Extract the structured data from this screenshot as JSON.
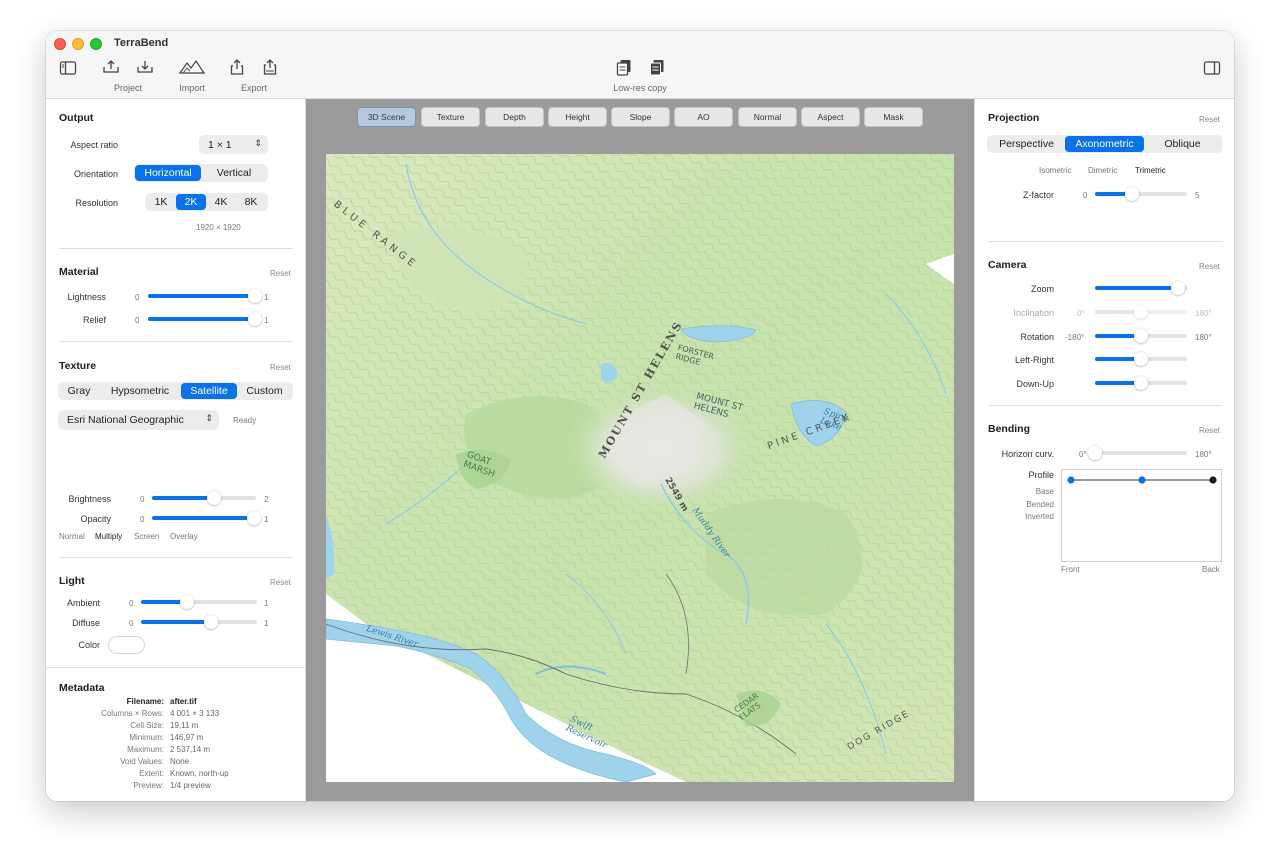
{
  "window": {
    "title": "TerraBend"
  },
  "toolbar": {
    "project_label": "Project",
    "import_label": "Import",
    "export_label": "Export",
    "lowres_label": "Low-res copy"
  },
  "output": {
    "title": "Output",
    "aspect_label": "Aspect ratio",
    "aspect_value": "1 × 1",
    "orientation_label": "Orientation",
    "orientation_options": [
      "Horizontal",
      "Vertical"
    ],
    "resolution_label": "Resolution",
    "resolution_options": [
      "1K",
      "2K",
      "4K",
      "8K"
    ],
    "resolution_size": "1920 × 1920"
  },
  "material": {
    "title": "Material",
    "reset": "Reset",
    "lightness_label": "Lightness",
    "lightness_min": "0",
    "lightness_max": "1",
    "lightness_value": 0.98,
    "relief_label": "Relief",
    "relief_min": "0",
    "relief_max": "1",
    "relief_value": 0.98
  },
  "texture": {
    "title": "Texture",
    "reset": "Reset",
    "modes": [
      "Gray",
      "Hypsometric",
      "Satellite",
      "Custom"
    ],
    "source": "Esri National Geographic",
    "status": "Ready",
    "brightness_label": "Brightness",
    "brightness_min": "0",
    "brightness_max": "2",
    "brightness_value": 1.2,
    "opacity_label": "Opacity",
    "opacity_min": "0",
    "opacity_max": "1",
    "opacity_value": 0.98,
    "blend_modes": [
      "Normal",
      "Multiply",
      "Screen",
      "Overlay"
    ]
  },
  "light": {
    "title": "Light",
    "reset": "Reset",
    "ambient_label": "Ambient",
    "ambient_min": "0",
    "ambient_max": "1",
    "ambient_value": 0.4,
    "diffuse_label": "Diffuse",
    "diffuse_min": "0",
    "diffuse_max": "1",
    "diffuse_value": 0.6,
    "color_label": "Color"
  },
  "metadata": {
    "title": "Metadata",
    "filename_label": "Filename:",
    "filename": "after.tif",
    "rows": [
      {
        "k": "Columns × Rows:",
        "v": "4 001 × 3 133"
      },
      {
        "k": "Cell Size:",
        "v": "19,11 m"
      },
      {
        "k": "Minimum:",
        "v": "146,97 m"
      },
      {
        "k": "Maximum:",
        "v": "2 537,14 m"
      },
      {
        "k": "Void Values:",
        "v": "None"
      },
      {
        "k": "Extent:",
        "v": "Known, north-up"
      },
      {
        "k": "Preview:",
        "v": "1/4 preview"
      }
    ]
  },
  "view_tabs": [
    "3D Scene",
    "Texture",
    "Depth",
    "Height",
    "Slope",
    "AO",
    "Normal",
    "Aspect",
    "Mask"
  ],
  "map": {
    "labels": [
      "MOUNT ST HELENS",
      "MOUNT ST HELENS",
      "2549 m",
      "Muddy River",
      "Lewis River",
      "Swift Reservoir",
      "Spirit Lake",
      "GOAT MARSH",
      "FORSTER RIDGE",
      "CEDAR FLATS",
      "PINE CREEK",
      "BLUE RANGE",
      "DOG RIDGE"
    ]
  },
  "projection": {
    "title": "Projection",
    "reset": "Reset",
    "modes": [
      "Perspective",
      "Axonometric",
      "Oblique"
    ],
    "sub_modes": [
      "Isometric",
      "Dimetric",
      "Trimetric"
    ],
    "zfactor_label": "Z-factor",
    "zfactor_min": "0",
    "zfactor_max": "5",
    "zfactor_value": 2.0
  },
  "camera": {
    "title": "Camera",
    "reset": "Reset",
    "zoom_label": "Zoom",
    "zoom_value": 0.9,
    "inclination_label": "Inclination",
    "inclination_min": "0°",
    "inclination_max": "180°",
    "inclination_value": 0.5,
    "rotation_label": "Rotation",
    "rotation_min": "-180°",
    "rotation_max": "180°",
    "rotation_value": 0.5,
    "leftright_label": "Left-Right",
    "leftright_value": 0.5,
    "downup_label": "Down-Up",
    "downup_value": 0.5
  },
  "bending": {
    "title": "Bending",
    "reset": "Reset",
    "horizon_label": "Horizon curv.",
    "horizon_min": "0°",
    "horizon_max": "180°",
    "horizon_value": 0.0,
    "profile_label": "Profile",
    "profile_options": [
      "Base",
      "Bended",
      "Inverted"
    ],
    "front_label": "Front",
    "back_label": "Back"
  },
  "colors": {
    "accent": "#0a72e8",
    "water": "#9fd3ec",
    "land": "#cfe6b0"
  }
}
